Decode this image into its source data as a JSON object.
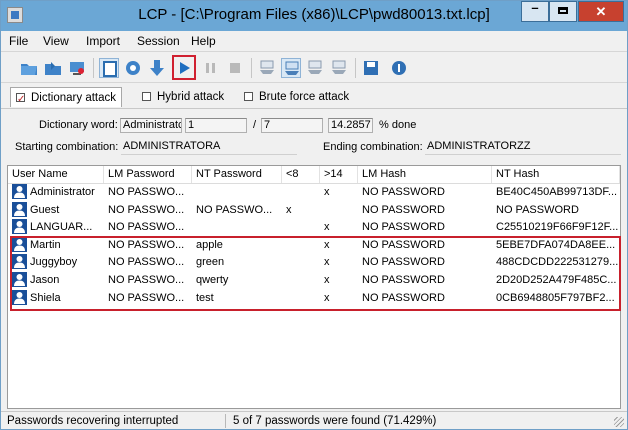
{
  "window": {
    "title": "LCP - [C:\\Program Files (x86)\\LCP\\pwd80013.txt.lcp]",
    "min_label": "–",
    "close_label": "✕"
  },
  "menu": [
    "File",
    "View",
    "Import",
    "Session",
    "Help"
  ],
  "toolbar": {
    "icons": [
      "open-icon",
      "import-icon",
      "import-remote-icon",
      "new-session-icon",
      "options-icon",
      "download-icon",
      "start-icon",
      "pause-icon",
      "stop-icon",
      "lm-hash-icon",
      "nt-hash-icon",
      "lm-nt-icon",
      "nt-lm-icon",
      "save-icon",
      "help-icon"
    ]
  },
  "tabs": [
    {
      "label": "Dictionary attack",
      "checked": true
    },
    {
      "label": "Hybrid attack",
      "checked": false
    },
    {
      "label": "Brute force attack",
      "checked": false
    }
  ],
  "attack": {
    "dictionary_word_label": "Dictionary word:",
    "dictionary_word": "Administratc",
    "word_index": "1",
    "slash": "/",
    "word_total": "7",
    "percent": "14.2857",
    "percent_label": "% done",
    "starting_label": "Starting combination:",
    "starting_value": "ADMINISTRATORA",
    "ending_label": "Ending combination:",
    "ending_value": "ADMINISTRATORZZ"
  },
  "grid": {
    "columns": [
      "User Name",
      "LM Password",
      "NT Password",
      "<8",
      ">14",
      "LM Hash",
      "NT Hash"
    ],
    "rows": [
      [
        "Administrator",
        "NO PASSWO...",
        "",
        "",
        "x",
        "NO PASSWORD",
        "BE40C450AB99713DF..."
      ],
      [
        "Guest",
        "NO PASSWO...",
        "NO PASSWO...",
        "x",
        "",
        "NO PASSWORD",
        "NO PASSWORD"
      ],
      [
        "LANGUAR...",
        "NO PASSWO...",
        "",
        "",
        "x",
        "NO PASSWORD",
        "C25510219F66F9F12F..."
      ],
      [
        "Martin",
        "NO PASSWO...",
        "apple",
        "",
        "x",
        "NO PASSWORD",
        "5EBE7DFA074DA8EE..."
      ],
      [
        "Juggyboy",
        "NO PASSWO...",
        "green",
        "",
        "x",
        "NO PASSWORD",
        "488CDCDD222531279..."
      ],
      [
        "Jason",
        "NO PASSWO...",
        "qwerty",
        "",
        "x",
        "NO PASSWORD",
        "2D20D252A479F485C..."
      ],
      [
        "Shiela",
        "NO PASSWO...",
        "test",
        "",
        "x",
        "NO PASSWORD",
        "0CB6948805F797BF2..."
      ]
    ]
  },
  "status": {
    "left": "Passwords recovering interrupted",
    "right": "5 of 7 passwords were found (71.429%)"
  },
  "colors": {
    "titlebar": "#6ba7d5",
    "close": "#c7412f",
    "highlight": "#c8202c"
  }
}
